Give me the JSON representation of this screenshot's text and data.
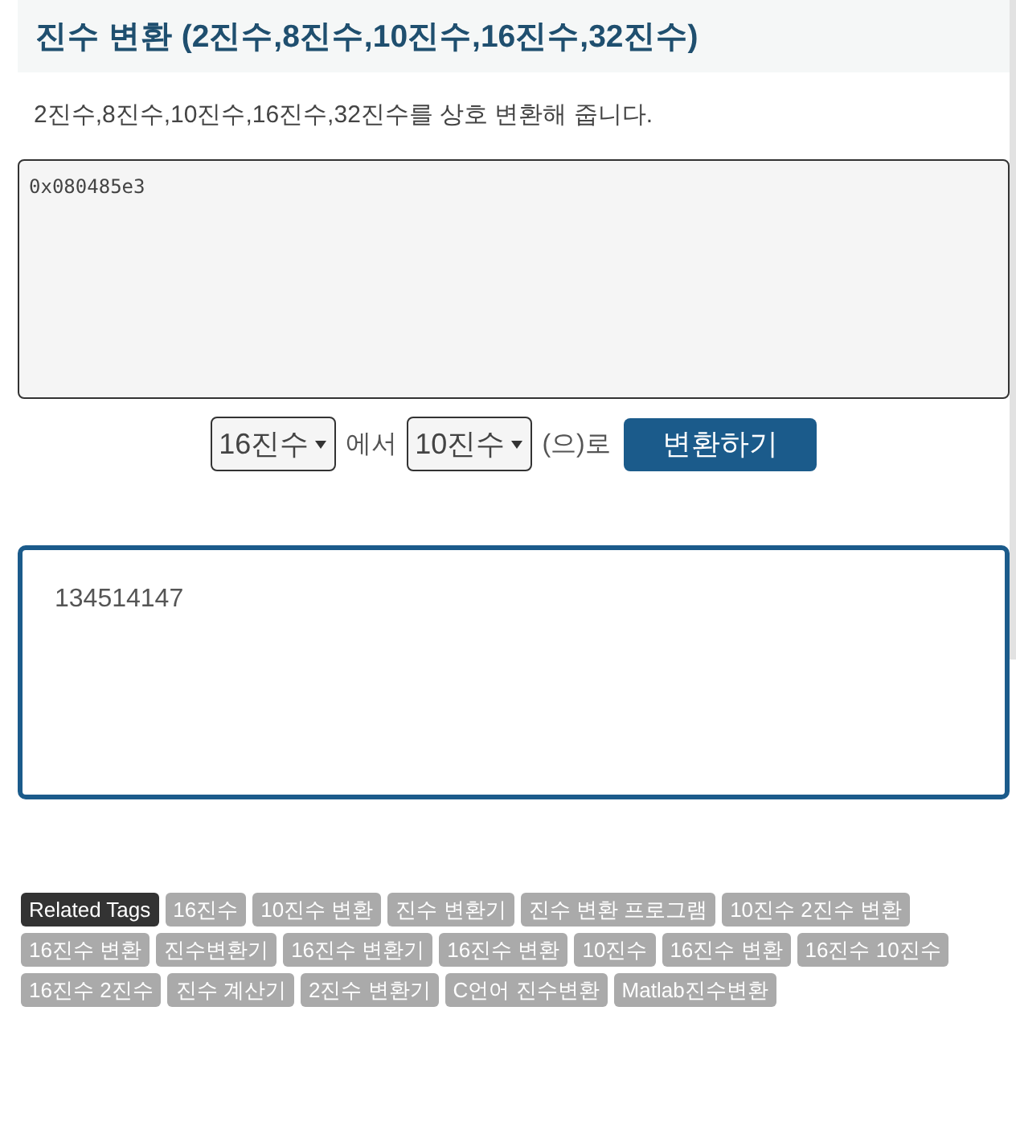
{
  "header": {
    "title": "진수 변환 (2진수,8진수,10진수,16진수,32진수)"
  },
  "description": "2진수,8진수,10진수,16진수,32진수를 상호 변환해 줍니다.",
  "input": {
    "value": "0x080485e3"
  },
  "converter": {
    "from": {
      "value": "16진수"
    },
    "from_suffix": "에서",
    "to": {
      "value": "10진수"
    },
    "to_suffix": "(으)로",
    "button": "변환하기"
  },
  "output": {
    "value": "134514147"
  },
  "tags": {
    "label": "Related Tags",
    "items": [
      "16진수",
      "10진수 변환",
      "진수 변환기",
      "진수 변환 프로그램",
      "10진수 2진수 변환",
      "16진수 변환",
      "진수변환기",
      "16진수 변환기",
      "16진수 변환",
      "10진수",
      "16진수 변환",
      "16진수 10진수",
      "16진수 2진수",
      "진수 계산기",
      "2진수 변환기",
      "C언어 진수변환",
      "Matlab진수변환"
    ]
  }
}
